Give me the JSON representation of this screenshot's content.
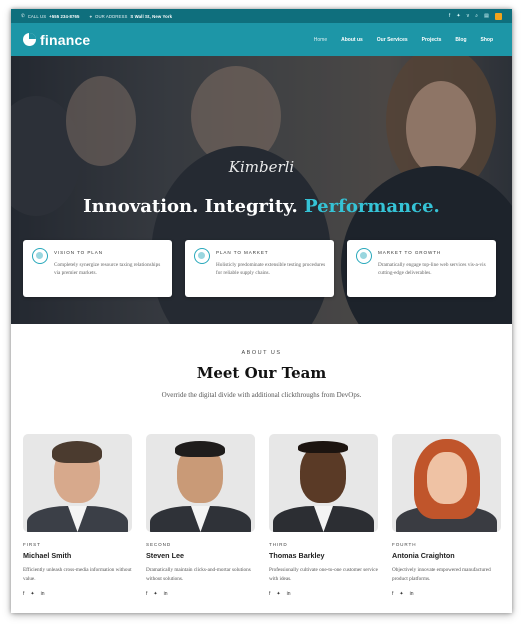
{
  "topbar": {
    "call_label": "CALL US",
    "phone": "+555 234-8765",
    "address_label": "OUR ADDRESS",
    "address": "S Wall St, New York",
    "social_icons": [
      "facebook-icon",
      "twitter-icon",
      "vimeo-icon",
      "search-icon",
      "cart-icon",
      "rss-icon"
    ]
  },
  "header": {
    "logo_text": "finance",
    "nav": [
      "Home",
      "About us",
      "Our Services",
      "Projects",
      "Blog",
      "Shop"
    ],
    "active_nav": "Home",
    "accent_color": "#1d96a7"
  },
  "hero": {
    "signature": "Kimberli",
    "tagline_part1": "Innovation. Integrity.",
    "tagline_part2": "Performance.",
    "accent_color": "#35c3d6",
    "cards": [
      {
        "title": "VISION TO PLAN",
        "text": "Completely synergize resource taxing relationships via premier markets.",
        "icon": "target-icon"
      },
      {
        "title": "PLAN TO MARKET",
        "text": "Holisticly predominate extensible testing procedures for reliable supply chains.",
        "icon": "chart-icon"
      },
      {
        "title": "MARKET TO GROWTH",
        "text": "Dramatically engage top-line web services vis-a-vis cutting-edge deliverables.",
        "icon": "pie-chart-icon"
      }
    ]
  },
  "about": {
    "eyebrow": "ABOUT US",
    "title": "Meet Our Team",
    "subtitle": "Override the digital divide with additional clickthroughs from DevOps."
  },
  "team": [
    {
      "rank": "FIRST",
      "name": "Michael Smith",
      "desc": "Efficiently unleash cross-media information without value."
    },
    {
      "rank": "SECOND",
      "name": "Steven Lee",
      "desc": "Dramatically maintain clicks-and-mortar solutions without solutions."
    },
    {
      "rank": "THIRD",
      "name": "Thomas Barkley",
      "desc": "Professionally cultivate one-to-one customer service with ideas."
    },
    {
      "rank": "FOURTH",
      "name": "Antonia Craighton",
      "desc": "Objectively innovate empowered manufactured product platforms."
    }
  ],
  "member_social": {
    "f": "f",
    "t": "✦",
    "in": "in"
  }
}
